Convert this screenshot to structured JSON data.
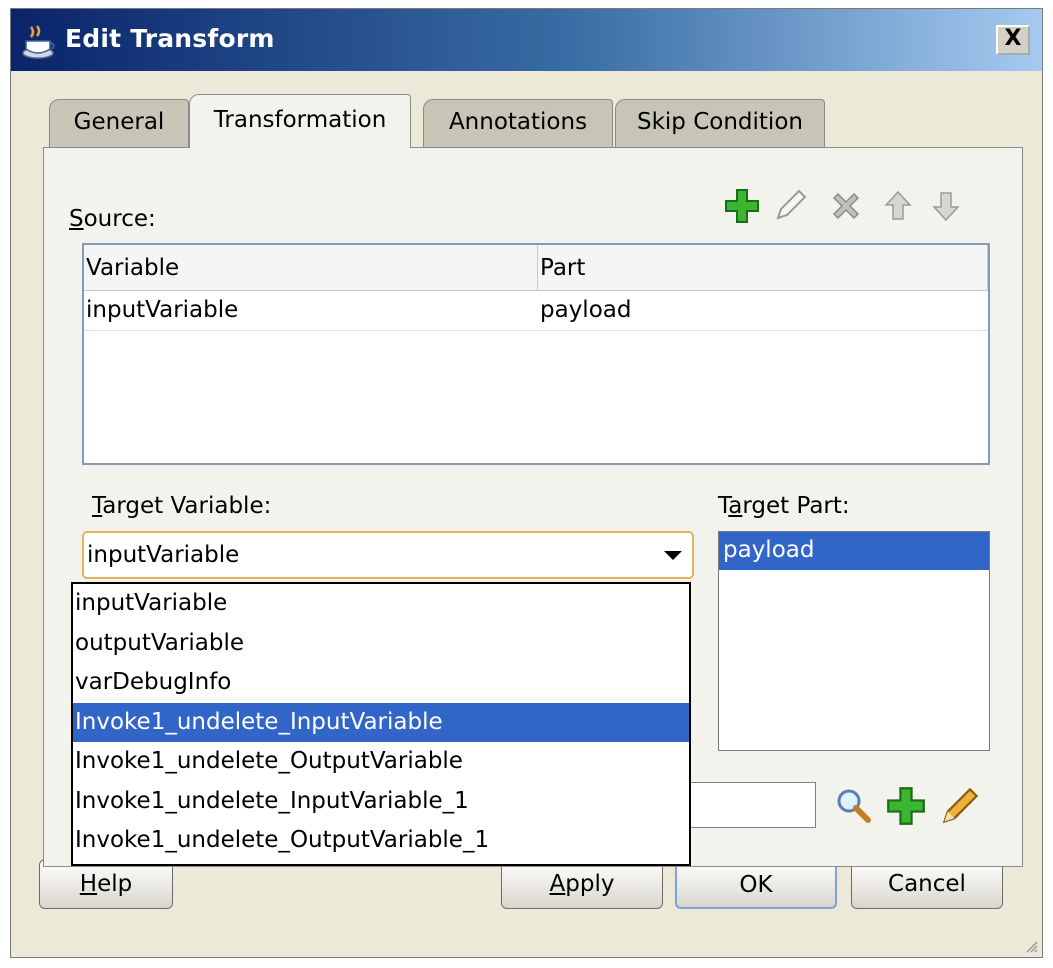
{
  "window": {
    "title": "Edit Transform",
    "close_label": "X"
  },
  "tabs": [
    {
      "label": "General"
    },
    {
      "label": "Transformation"
    },
    {
      "label": "Annotations"
    },
    {
      "label": "Skip Condition"
    }
  ],
  "active_tab": "Transformation",
  "source": {
    "label_mnemonic": "S",
    "label_rest": "ource:",
    "columns": [
      "Variable",
      "Part"
    ],
    "rows": [
      {
        "variable": "inputVariable",
        "part": "payload"
      }
    ],
    "toolbar": [
      "add-icon",
      "edit-icon",
      "delete-icon",
      "move-up-icon",
      "move-down-icon"
    ]
  },
  "target_variable": {
    "label_mnemonic": "T",
    "label_rest": "arget Variable:",
    "selected_value": "inputVariable",
    "options": [
      "inputVariable",
      "outputVariable",
      "varDebugInfo",
      "Invoke1_undelete_InputVariable",
      "Invoke1_undelete_OutputVariable",
      "Invoke1_undelete_InputVariable_1",
      "Invoke1_undelete_OutputVariable_1"
    ],
    "highlighted_option": "Invoke1_undelete_InputVariable"
  },
  "target_part": {
    "label_pre": "T",
    "label_mnemonic": "a",
    "label_rest": "rget Part:",
    "items": [
      "payload"
    ],
    "selected": "payload"
  },
  "mapper": {
    "icons": [
      "search-icon",
      "add-icon",
      "edit-icon"
    ]
  },
  "buttons": {
    "help_mnemonic": "H",
    "help_rest": "elp",
    "apply_mnemonic": "A",
    "apply_rest": "pply",
    "ok": "OK",
    "cancel": "Cancel"
  },
  "colors": {
    "title_gradient_start": "#0a246a",
    "title_gradient_end": "#a6caf0",
    "selection": "#3166c8",
    "add_green": "#3cb531"
  }
}
